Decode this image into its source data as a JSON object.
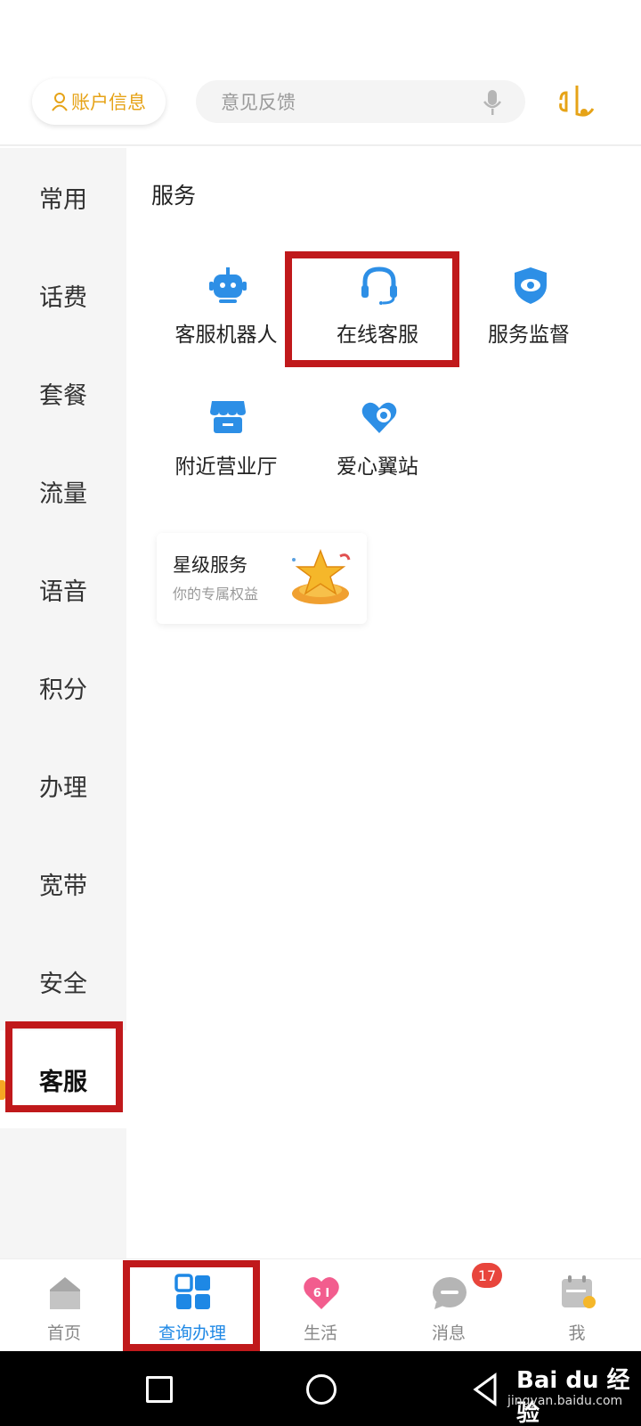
{
  "header": {
    "account_label": "账户信息",
    "search_placeholder": "意见反馈"
  },
  "sidebar": {
    "items": [
      {
        "label": "常用"
      },
      {
        "label": "话费"
      },
      {
        "label": "套餐"
      },
      {
        "label": "流量"
      },
      {
        "label": "语音"
      },
      {
        "label": "积分"
      },
      {
        "label": "办理"
      },
      {
        "label": "宽带"
      },
      {
        "label": "安全"
      },
      {
        "label": "客服",
        "active": true
      }
    ]
  },
  "main": {
    "section_title": "服务",
    "services": [
      {
        "label": "客服机器人",
        "icon": "robot-icon"
      },
      {
        "label": "在线客服",
        "icon": "headset-icon"
      },
      {
        "label": "服务监督",
        "icon": "shield-eye-icon"
      },
      {
        "label": "附近营业厅",
        "icon": "store-icon"
      },
      {
        "label": "爱心翼站",
        "icon": "heart-location-icon"
      }
    ],
    "star_card": {
      "title": "星级服务",
      "subtitle": "你的专属权益"
    }
  },
  "tabbar": {
    "tabs": [
      {
        "label": "首页",
        "icon": "home-icon"
      },
      {
        "label": "查询办理",
        "icon": "grid-icon",
        "active": true
      },
      {
        "label": "生活",
        "icon": "heart-61-icon"
      },
      {
        "label": "消息",
        "icon": "message-icon",
        "badge": "17"
      },
      {
        "label": "我",
        "icon": "sign-in-icon"
      }
    ]
  },
  "watermark": {
    "brand": "Bai du 经验",
    "url": "jingyan.baidu.com"
  },
  "colors": {
    "accent_blue": "#1e88e5",
    "accent_gold": "#e6a317",
    "highlight_red": "#c0191b",
    "badge_red": "#e8453c"
  }
}
